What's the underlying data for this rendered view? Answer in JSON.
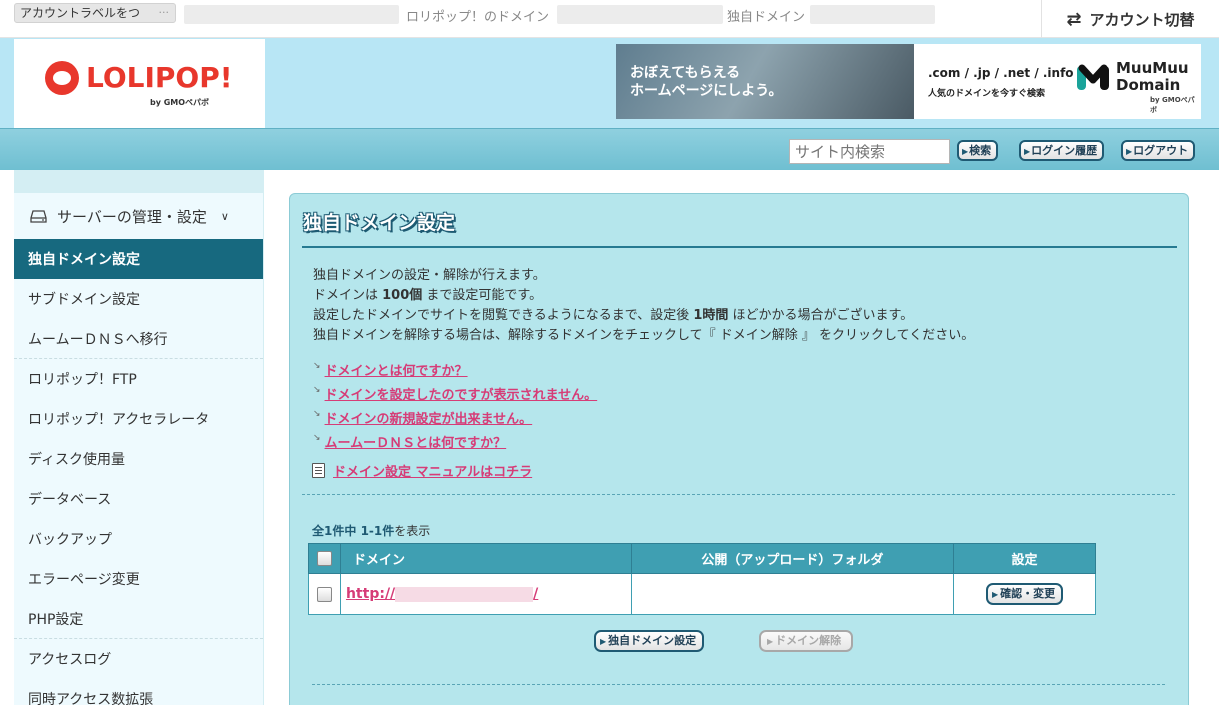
{
  "topbar": {
    "account_label": "アカウントラベルをつ",
    "account_label_more": "···",
    "lolipop_domain_label": "ロリポップ！のドメイン",
    "custom_domain_label": "独自ドメイン",
    "switch_account_label": "アカウント切替"
  },
  "header": {
    "logo_text": "LOLIPOP!",
    "logo_sub": "by GMOペパボ",
    "banner": {
      "headline_line1": "おぼえてもらえる",
      "headline_line2": "ホームページにしよう。",
      "tlds": ".com / .jp / .net / .info",
      "tagline": "人気のドメインを今すぐ検索",
      "brand_line1": "MuuMuu",
      "brand_line2": "Domain",
      "brand_by": "by GMOペパボ"
    }
  },
  "nav": {
    "search_placeholder": "サイト内検索",
    "search_button": "検索",
    "login_history_button": "ログイン履歴",
    "logout_button": "ログアウト"
  },
  "sidebar": {
    "section_title": "サーバーの管理・設定",
    "items": [
      {
        "label": "独自ドメイン設定"
      },
      {
        "label": "サブドメイン設定"
      },
      {
        "label": "ムームーＤＮＳへ移行"
      },
      {
        "label": "ロリポップ！FTP"
      },
      {
        "label": "ロリポップ！アクセラレータ"
      },
      {
        "label": "ディスク使用量"
      },
      {
        "label": "データベース"
      },
      {
        "label": "バックアップ"
      },
      {
        "label": "エラーページ変更"
      },
      {
        "label": "PHP設定"
      },
      {
        "label": "アクセスログ"
      },
      {
        "label": "同時アクセス数拡張"
      }
    ]
  },
  "main": {
    "title": "独自ドメイン設定",
    "desc": {
      "line1": "独自ドメインの設定・解除が行えます。",
      "line2_pre": "ドメインは ",
      "line2_bold": "100個",
      "line2_post": " まで設定可能です。",
      "line3_pre": "設定したドメインでサイトを閲覧できるようになるまで、設定後 ",
      "line3_bold": "1時間",
      "line3_post": " ほどかかる場合がございます。",
      "line4": "独自ドメインを解除する場合は、解除するドメインをチェックして『 ドメイン解除 』 をクリックしてください。"
    },
    "help_links": [
      {
        "label": "ドメインとは何ですか？"
      },
      {
        "label": "ドメインを設定したのですが表示されません。"
      },
      {
        "label": "ドメインの新規設定が出来ません。"
      },
      {
        "label": "ムームーＤＮＳとは何ですか？"
      }
    ],
    "manual_link": "ドメイン設定 マニュアルはコチラ",
    "count_prefix": "全",
    "count_total": "1件",
    "count_mid": "中 ",
    "count_range": "1-1件",
    "count_suffix": "を表示",
    "table": {
      "headers": [
        "ドメイン",
        "公開（アップロード）フォルダ",
        "設定"
      ],
      "rows": [
        {
          "url_prefix": "http://",
          "url_suffix": "/",
          "folder": "",
          "action": "確認・変更"
        }
      ]
    },
    "add_button": "独自ドメイン設定",
    "remove_button": "ドメイン解除"
  }
}
